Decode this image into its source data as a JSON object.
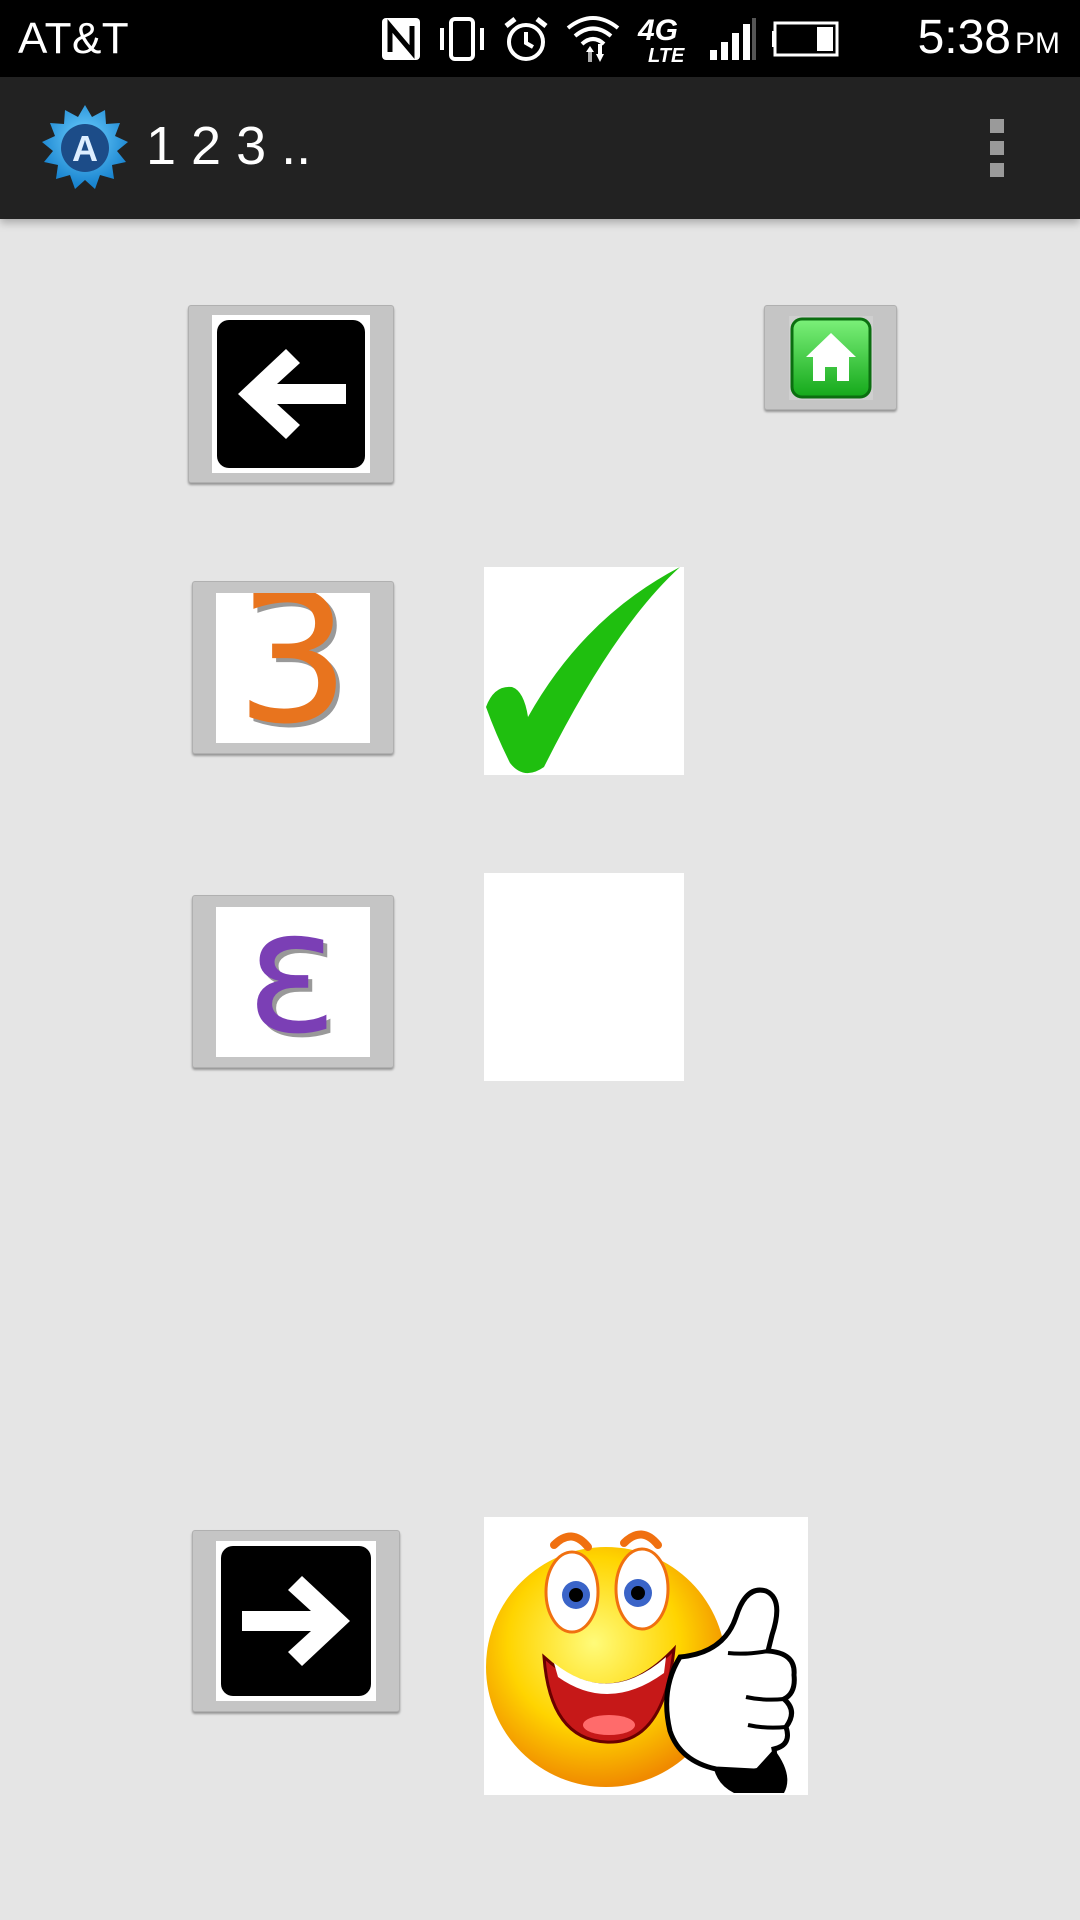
{
  "status_bar": {
    "carrier": "AT&T",
    "time": "5:38",
    "am_pm": "PM",
    "icons": [
      "nfc-icon",
      "vibrate-icon",
      "alarm-icon",
      "wifi-icon",
      "lte-icon",
      "signal-icon",
      "battery-icon"
    ],
    "lte_label": "4G",
    "lte_sub": "LTE"
  },
  "action_bar": {
    "title": "1 2 3 ..",
    "app_icon_letter": "A"
  },
  "game": {
    "option_1_symbol": "3",
    "option_1_color": "#e8741e",
    "option_2_symbol": "ε",
    "option_2_color": "#7b3fb5",
    "correct_mark_color": "#1fbf0f"
  }
}
